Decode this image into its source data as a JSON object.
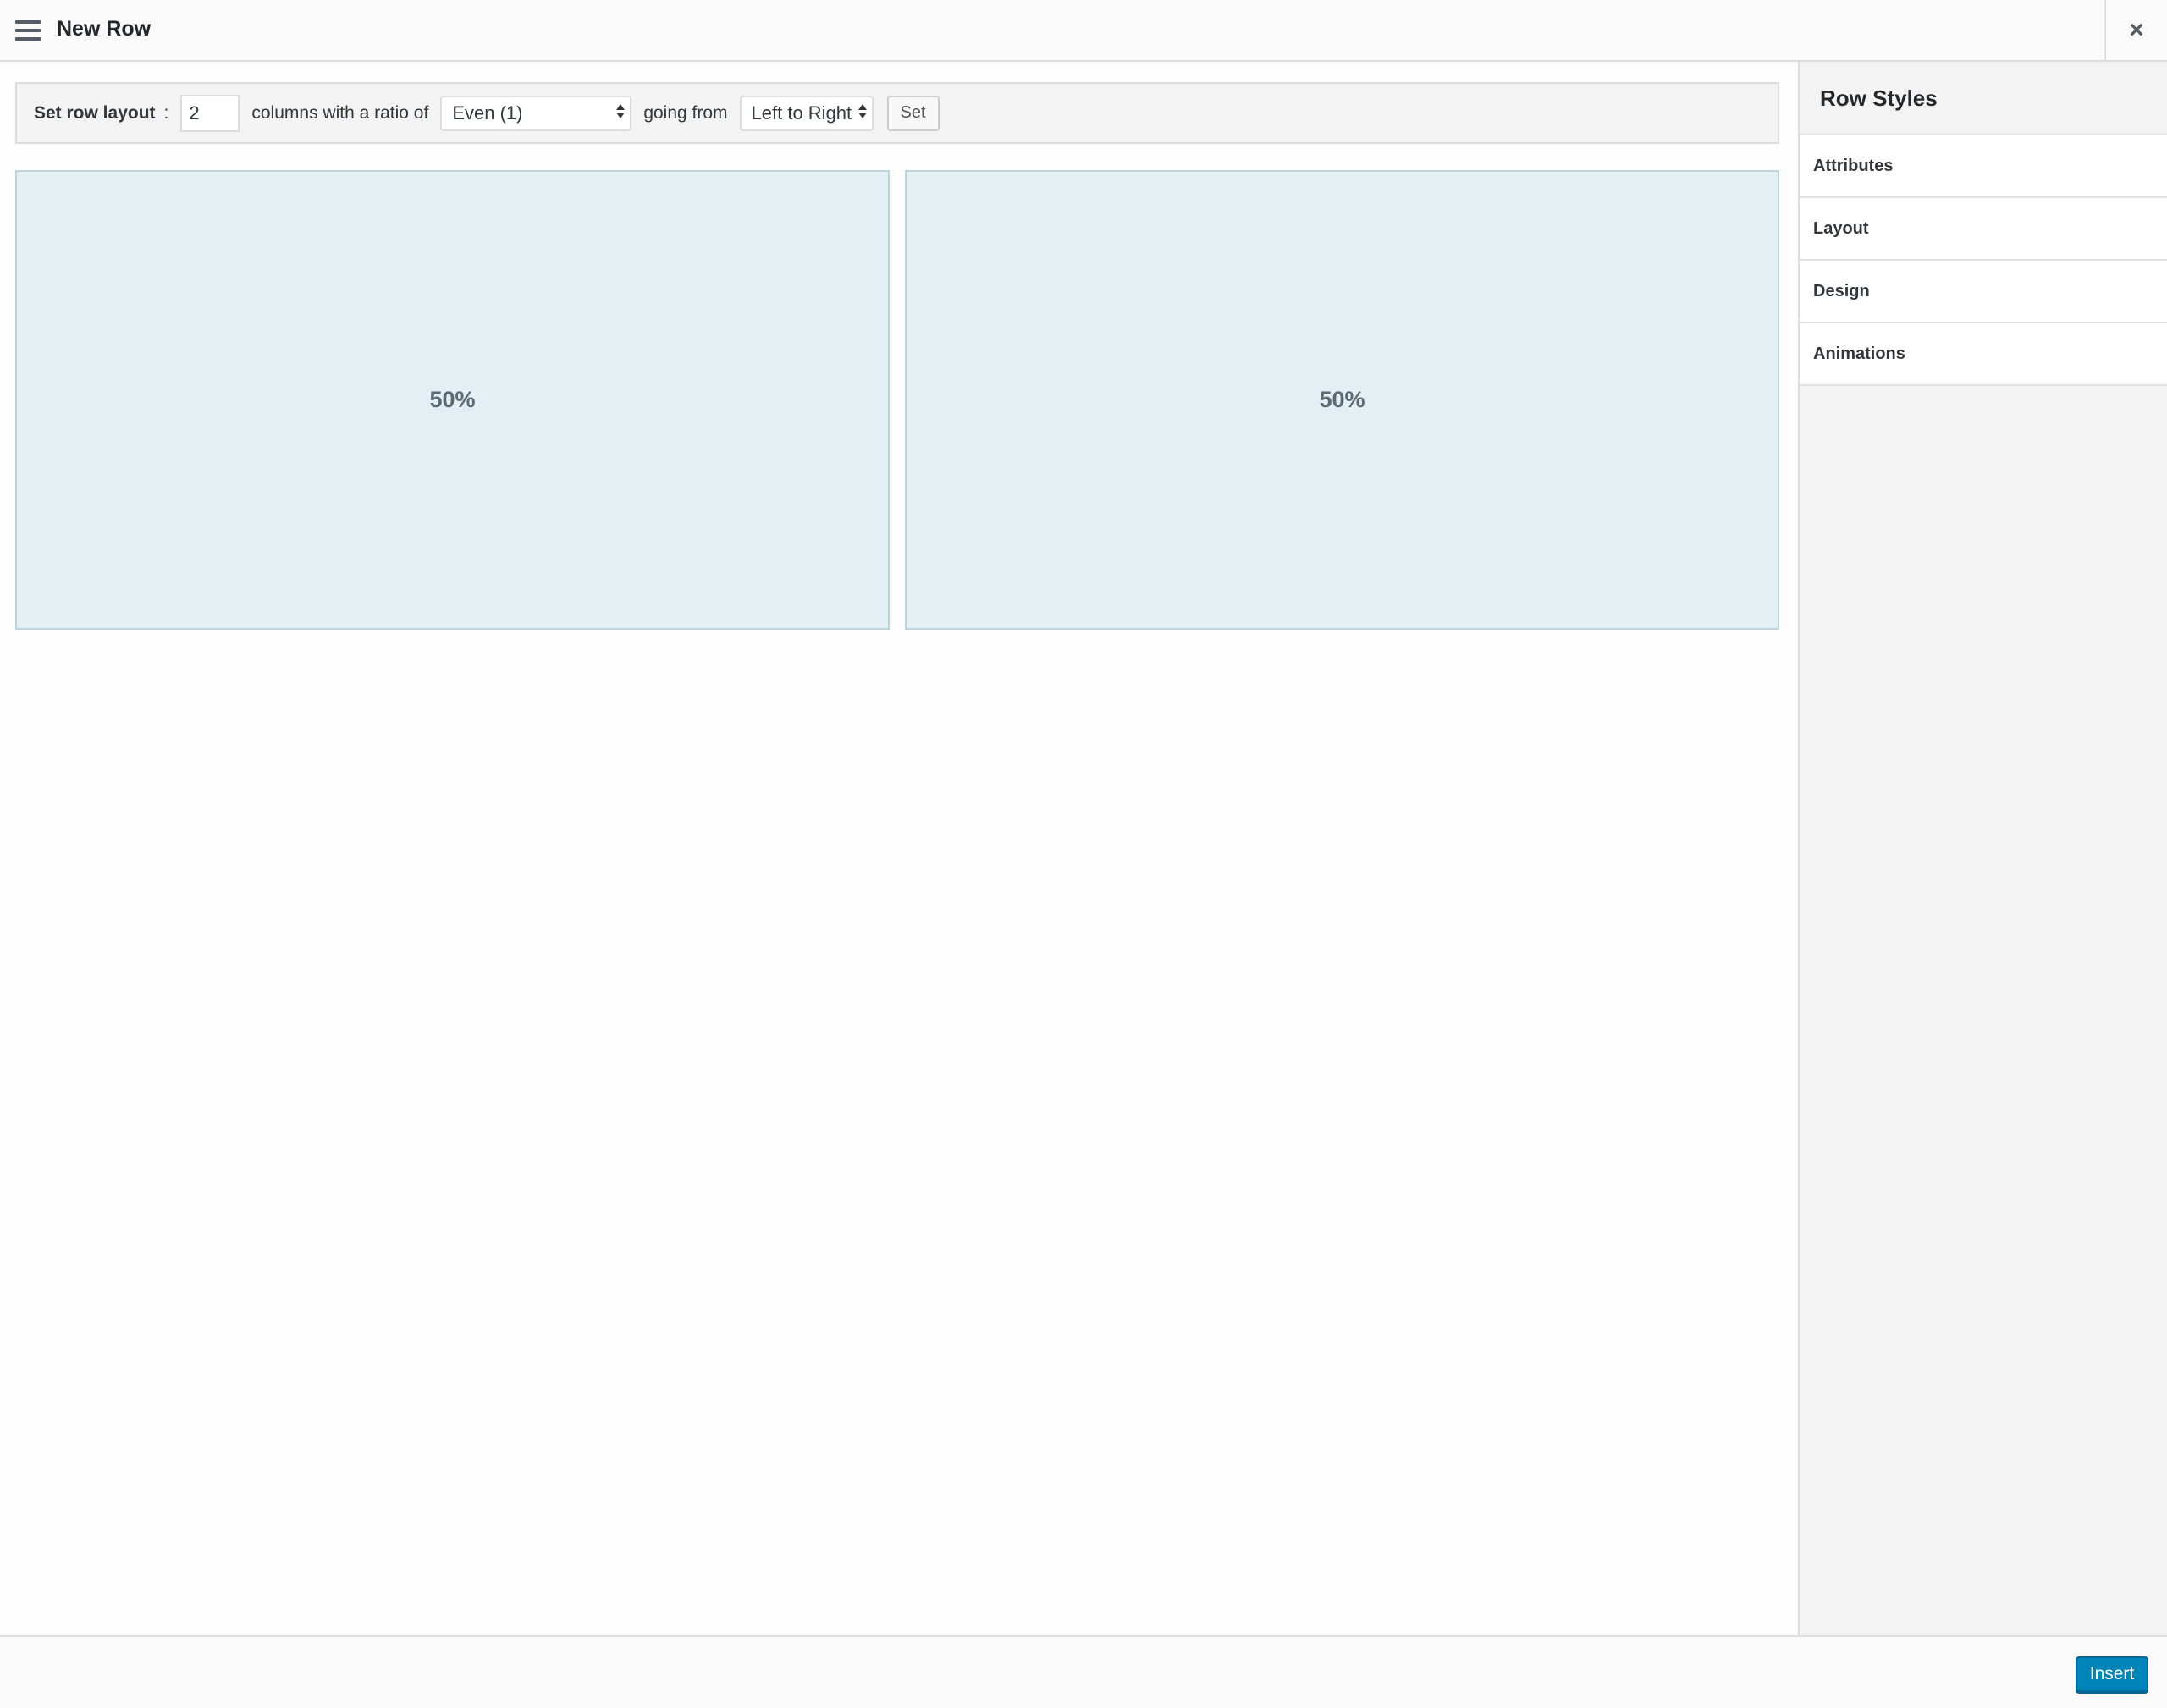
{
  "header": {
    "title": "New Row",
    "close_glyph": "×",
    "menu_icon": "hamburger-menu-icon",
    "close_icon": "close-icon"
  },
  "toolbar": {
    "label": "Set row layout",
    "colon": ":",
    "columns_value": "2",
    "columns_text": "columns with a ratio of",
    "ratio_selected": "Even (1)",
    "direction_text": "going from",
    "direction_selected": "Left to Right",
    "set_label": "Set"
  },
  "cells": [
    {
      "label": "50%",
      "weight": 0.5
    },
    {
      "label": "50%",
      "weight": 0.5
    }
  ],
  "sidebar": {
    "title": "Row Styles",
    "items": [
      {
        "label": "Attributes"
      },
      {
        "label": "Layout"
      },
      {
        "label": "Design"
      },
      {
        "label": "Animations"
      }
    ]
  },
  "footer": {
    "insert_label": "Insert"
  },
  "colors": {
    "accent": "#0085ba",
    "cell_background": "#e4eff4",
    "cell_border": "#bdd4de"
  }
}
